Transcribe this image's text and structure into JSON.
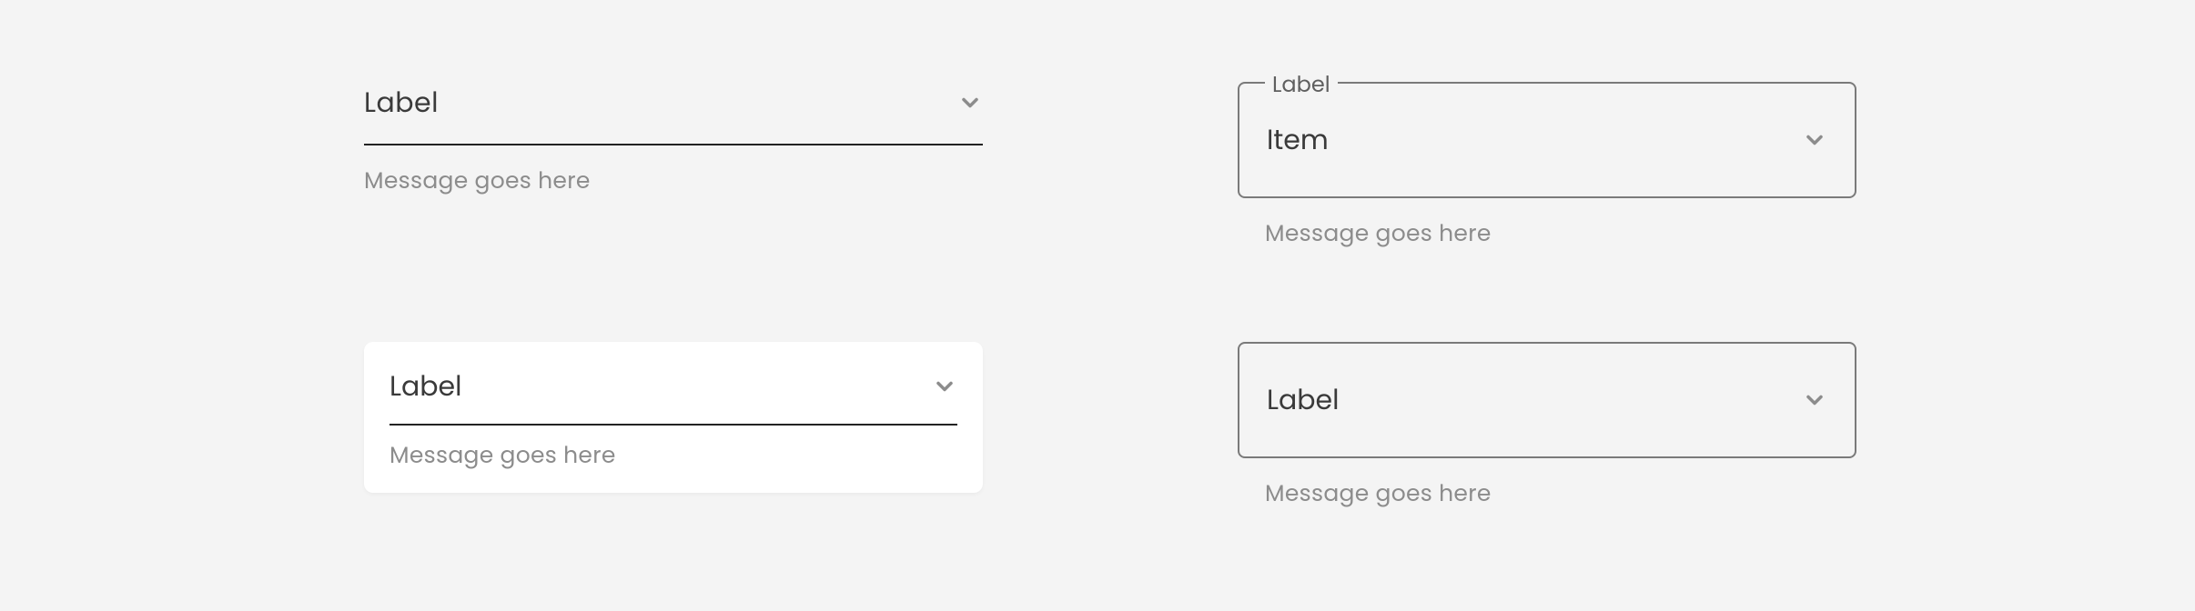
{
  "variants": {
    "a": {
      "label": "Label",
      "helper": "Message goes here"
    },
    "b": {
      "legend": "Label",
      "value": "Item",
      "helper": "Message goes here"
    },
    "c": {
      "label": "Label",
      "helper": "Message goes here"
    },
    "d": {
      "value": "Label",
      "helper": "Message goes here"
    }
  },
  "icons": {
    "chevron": "chevron-down"
  }
}
